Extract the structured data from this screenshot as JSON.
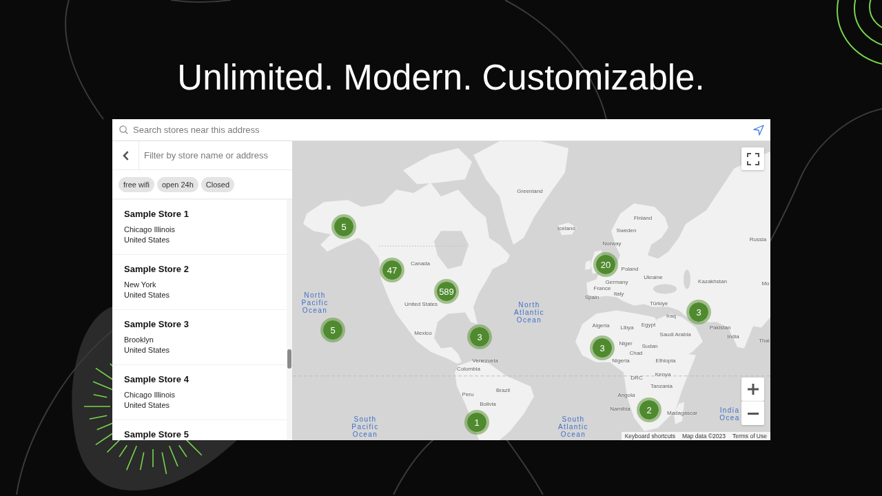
{
  "headline": "Unlimited. Modern. Customizable.",
  "search": {
    "placeholder": "Search stores near this address"
  },
  "sidebar": {
    "filter": {
      "placeholder": "Filter by store name or address"
    },
    "tags": [
      {
        "label": "free wifi",
        "selected": false
      },
      {
        "label": "open 24h",
        "selected": false
      },
      {
        "label": "Closed",
        "selected": false
      }
    ],
    "stores": [
      {
        "name": "Sample Store 1",
        "address": [
          "Chicago Illinois",
          "United States"
        ]
      },
      {
        "name": "Sample Store 2",
        "address": [
          "New York",
          "United States"
        ]
      },
      {
        "name": "Sample Store 3",
        "address": [
          "Brooklyn",
          "United States"
        ]
      },
      {
        "name": "Sample Store 4",
        "address": [
          "Chicago Illinois",
          "United States"
        ]
      },
      {
        "name": "Sample Store 5"
      }
    ]
  },
  "map": {
    "clusters": [
      "5",
      "47",
      "589",
      "5",
      "3",
      "1",
      "20",
      "3",
      "3",
      "2"
    ],
    "country_labels": [
      "Greenland",
      "Canada",
      "United States",
      "Mexico",
      "Venezuela",
      "Colombia",
      "Peru",
      "Brazil",
      "Bolivia",
      "Iceland",
      "Finland",
      "Sweden",
      "Norway",
      "Poland",
      "Germany",
      "France",
      "Italy",
      "Spain",
      "Ukraine",
      "Kazakhstan",
      "Russia",
      "Türkiye",
      "Iraq",
      "Pakistan",
      "India",
      "Algeria",
      "Libya",
      "Egypt",
      "Saudi Arabia",
      "Niger",
      "Chad",
      "Sudan",
      "Nigeria",
      "Ethiopia",
      "DRC",
      "Kenya",
      "Tanzania",
      "Angola",
      "Namibia",
      "Madagascar",
      "Thai",
      "Mo"
    ],
    "ocean_labels": [
      "North Pacific Ocean",
      "North Atlantic Ocean",
      "South Pacific Ocean",
      "South Atlantic Ocean",
      "India Ocea"
    ],
    "attribution": [
      "Keyboard shortcuts",
      "Map data ©2023",
      "Terms of Use"
    ]
  }
}
